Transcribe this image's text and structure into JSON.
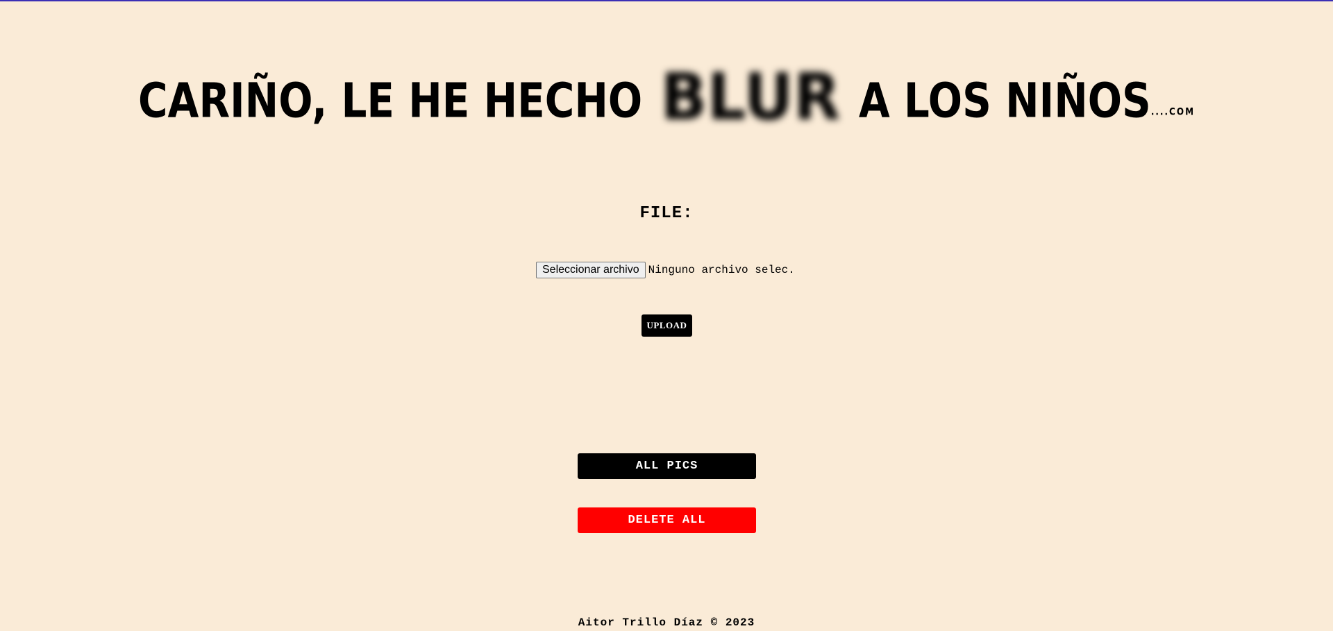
{
  "header": {
    "title_before": "CARIÑO, LE HE HECHO",
    "title_blur": "BLUR",
    "title_after": "A LOS NIÑOS",
    "title_ellipsis": "...",
    "title_suffix": ".COM"
  },
  "upload_form": {
    "file_label": "FILE:",
    "file_button_label": "Seleccionar archivo",
    "file_status": "Ninguno archivo selec.",
    "upload_label": "UPLOAD"
  },
  "actions": {
    "all_pics_label": "ALL PICS",
    "delete_all_label": "DELETE ALL"
  },
  "footer": {
    "text": "Aitor Trillo Díaz © 2023"
  },
  "colors": {
    "background": "#faebd7",
    "accent_delete": "#ff0000",
    "button_dark": "#000000"
  }
}
